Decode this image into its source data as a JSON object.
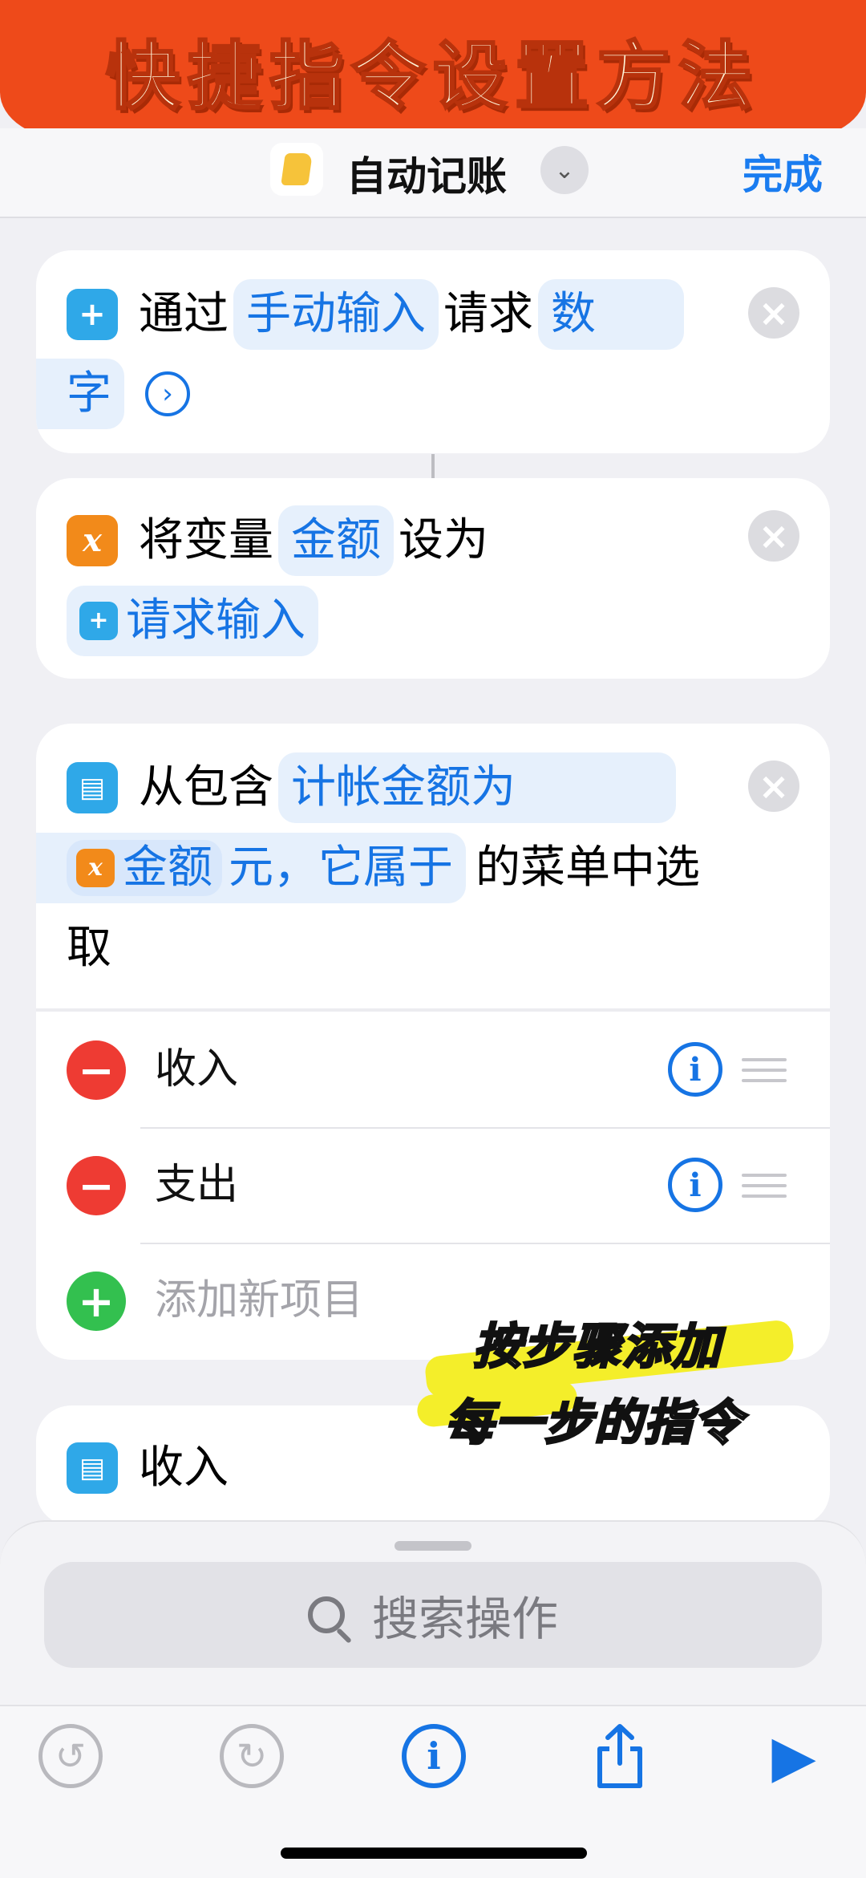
{
  "banner": {
    "title": "快捷指令设置方法"
  },
  "nav": {
    "title": "自动记账",
    "done_label": "完成"
  },
  "action1": {
    "text_via": "通过",
    "token_method": "手动输入",
    "text_request": "请求",
    "token_type_part1": "数",
    "token_type_part2": "字"
  },
  "action2": {
    "text_set": "将变量",
    "token_var": "金额",
    "text_as": "设为",
    "token_value": "请求输入"
  },
  "action3": {
    "text_from": "从包含",
    "token_prompt_part1": "计帐金额为",
    "token_var": "金额",
    "token_prompt_part2": "元，它属于",
    "text_menu_part1": "的菜单中选",
    "text_menu_part2": "取",
    "items": [
      {
        "label": "收入"
      },
      {
        "label": "支出"
      }
    ],
    "add_placeholder": "添加新项目"
  },
  "action4": {
    "label": "收入"
  },
  "overlay": {
    "line1": "按步骤添加",
    "line2": "每一步的指令"
  },
  "sheet": {
    "search_placeholder": "搜索操作"
  }
}
